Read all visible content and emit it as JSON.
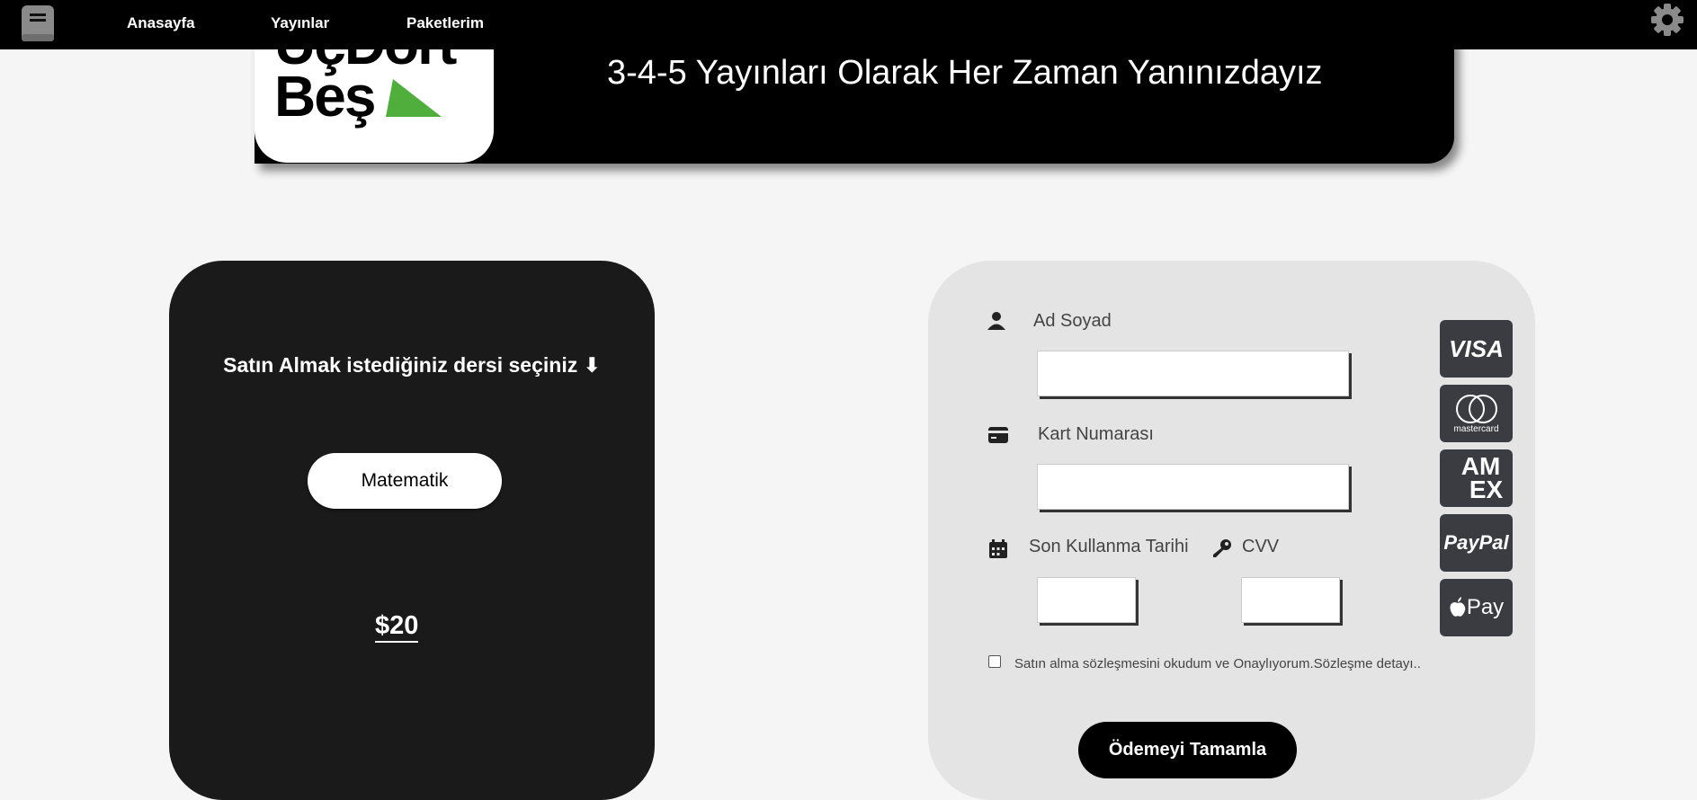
{
  "nav": {
    "links": [
      "Anasayfa",
      "Yayınlar",
      "Paketlerim"
    ],
    "icons": {
      "left": "book-icon",
      "right": "gear-icon"
    }
  },
  "hero": {
    "logo_line1": "ÜçDört",
    "logo_line2": "Beş",
    "title": "3-4-5 Yayınları Olarak Her Zaman Yanınızdayız"
  },
  "course": {
    "title": "Satın Almak istediğiniz dersi seçiniz ⬇",
    "button_label": "Matematik",
    "price": "$20"
  },
  "payment": {
    "name_label": "Ad Soyad",
    "card_label": "Kart Numarası",
    "expiry_label": "Son Kullanma Tarihi",
    "cvv_label": "CVV",
    "agreement_text": "Satın alma sözleşmesini okudum ve Onaylıyorum.Sözleşme detayı..",
    "submit_label": "Ödemeyi Tamamla",
    "card_logos": {
      "visa": "VISA",
      "mastercard": "mastercard",
      "amex_line1": "AM",
      "amex_line2": "EX",
      "paypal": "PayPal",
      "applepay": " Pay"
    }
  },
  "colors": {
    "accent": "#4fae3c",
    "card_dark": "#1a1a1a",
    "pay_bg": "#e4e4e4",
    "logo_bg": "#3a3c42"
  }
}
